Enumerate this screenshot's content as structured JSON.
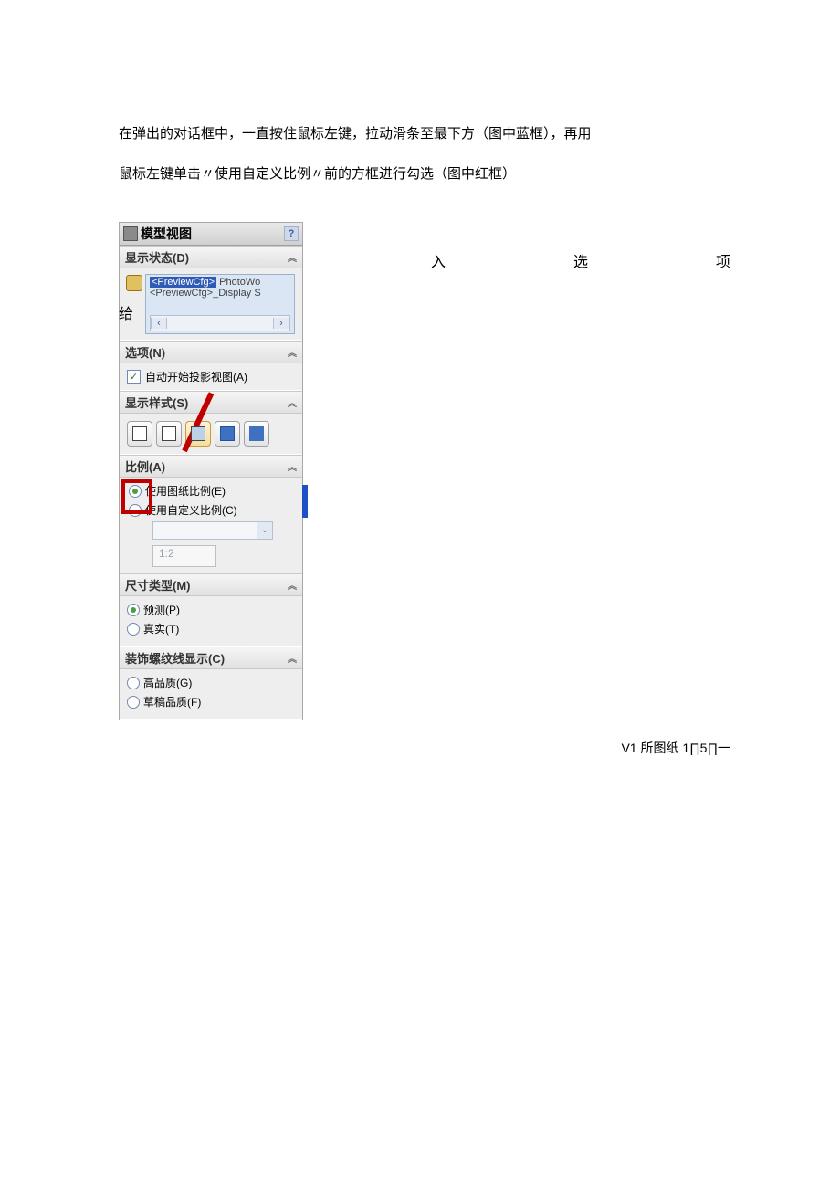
{
  "paragraph1": "在弹出的对话框中，一直按住鼠标左键，拉动滑条至最下方（图中蓝框），再用",
  "paragraph2": "鼠标左键单击〃使用自定义比例〃前的方框进行勾选（图中红框）",
  "row_labels": {
    "a": "给",
    "b": "入",
    "c": "选",
    "d": "项"
  },
  "panel": {
    "title": "模型视图",
    "sections": {
      "display_state": {
        "header": "显示状态(D)",
        "line1_tag": "<PreviewCfg>",
        "line1_rest": " PhotoWo",
        "line2": "<PreviewCfg>_Display S"
      },
      "options": {
        "header": "选项(N)",
        "chk_label": "自动开始投影视图(A)",
        "chk_checked": true
      },
      "display_style": {
        "header": "显示样式(S)"
      },
      "scale": {
        "header": "比例(A)",
        "radio1": "使用图纸比例(E)",
        "radio2": "使用自定义比例(C)",
        "ratio": "1:2"
      },
      "dim_type": {
        "header": "尺寸类型(M)",
        "radio1": "预测(P)",
        "radio2": "真实(T)"
      },
      "thread": {
        "header": "装饰螺纹线显示(C)",
        "radio1": "高品质(G)",
        "radio2": "草稿品质(F)"
      }
    }
  },
  "footer": "V1 所图纸 1∏5∏一"
}
